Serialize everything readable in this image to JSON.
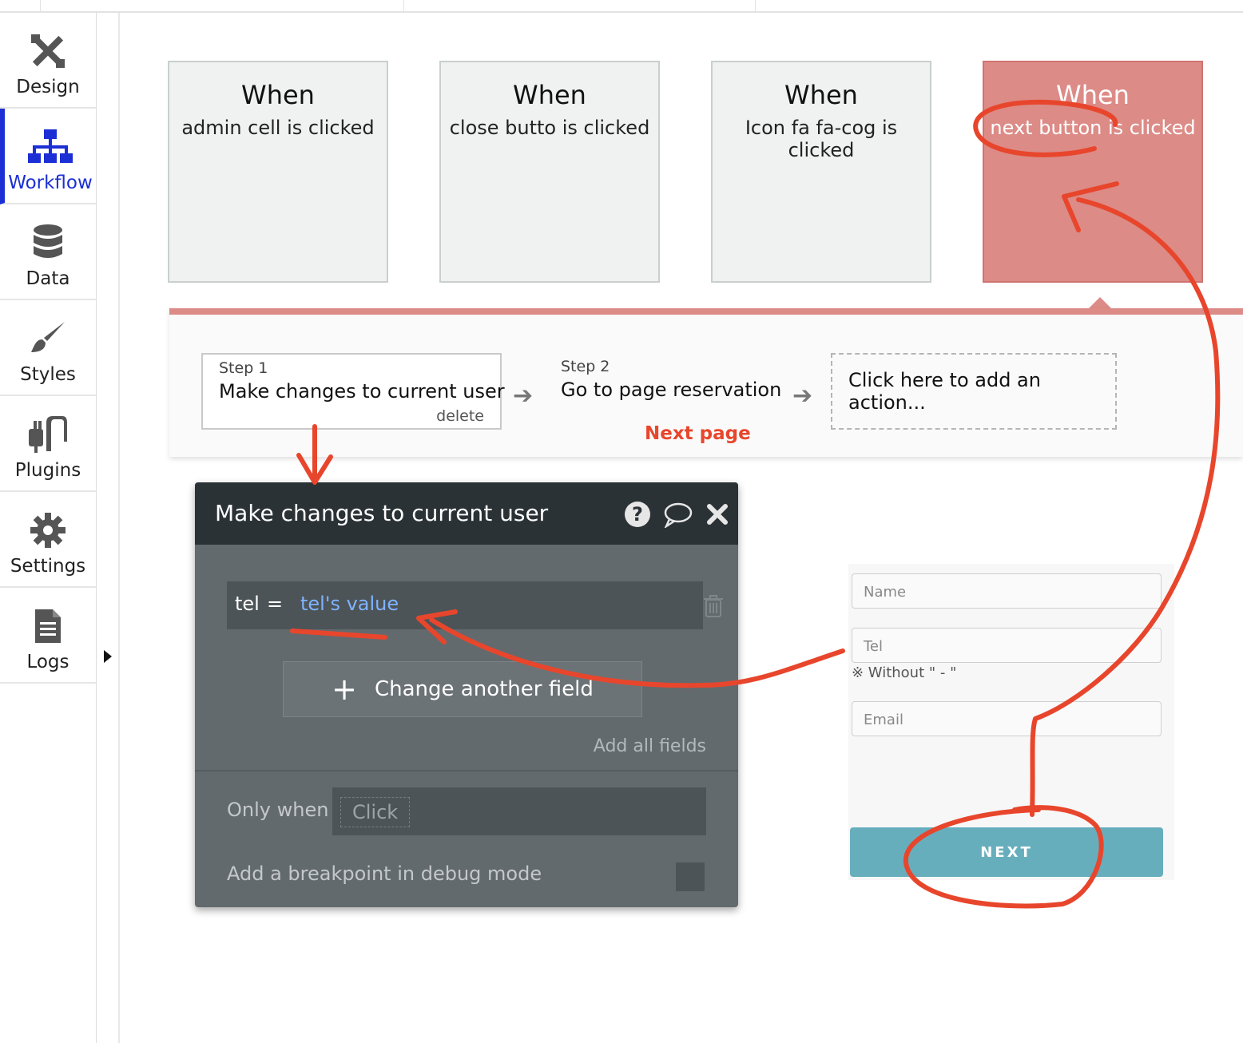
{
  "sidebar": {
    "items": [
      {
        "label": "Design",
        "icon": "design-icon"
      },
      {
        "label": "Workflow",
        "icon": "workflow-icon",
        "active": true
      },
      {
        "label": "Data",
        "icon": "database-icon"
      },
      {
        "label": "Styles",
        "icon": "brush-icon"
      },
      {
        "label": "Plugins",
        "icon": "plug-icon"
      },
      {
        "label": "Settings",
        "icon": "gear-icon"
      },
      {
        "label": "Logs",
        "icon": "document-icon"
      }
    ]
  },
  "events": [
    {
      "when": "When",
      "desc": "admin cell is clicked"
    },
    {
      "when": "When",
      "desc": "close butto is clicked"
    },
    {
      "when": "When",
      "desc": "Icon fa fa-cog is clicked"
    },
    {
      "when": "When",
      "desc": "next button is clicked",
      "selected": true
    }
  ],
  "workflow": {
    "step1": {
      "label": "Step 1",
      "title": "Make changes to current user",
      "delete": "delete"
    },
    "step2": {
      "label": "Step 2",
      "title": "Go to page reservation"
    },
    "add_action": "Click here to add an action...",
    "annotation": "Next page"
  },
  "panel": {
    "title": "Make changes to current user",
    "field": {
      "name": "tel",
      "eq": "=",
      "value": "tel's value"
    },
    "change_field": "Change another field",
    "add_all_fields": "Add all fields",
    "only_when": "Only when",
    "only_when_placeholder": "Click",
    "breakpoint": "Add a breakpoint in debug mode"
  },
  "form": {
    "name_placeholder": "Name",
    "tel_placeholder": "Tel",
    "tel_hint": "※ Without \" - \"",
    "email_placeholder": "Email",
    "next_label": "NEXT"
  },
  "colors": {
    "accent_blue": "#1b2fd4",
    "selected_event": "#dc8b87",
    "panel_bg": "#636a6e",
    "panel_header": "#2b3235",
    "next_button": "#67aebd",
    "annotation_red": "#e8462c"
  }
}
